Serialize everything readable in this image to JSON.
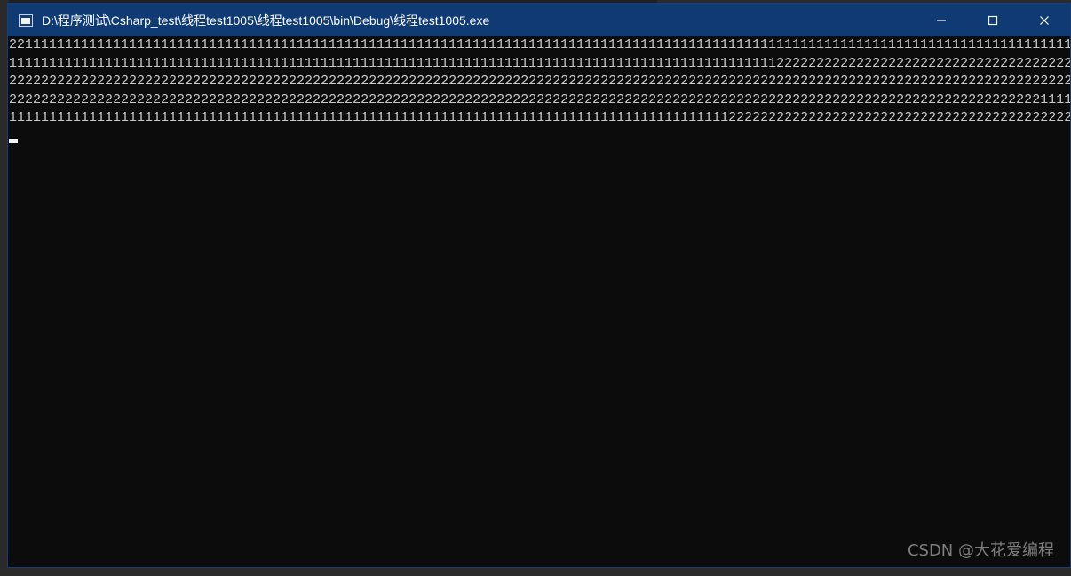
{
  "window": {
    "title": "D:\\程序测试\\Csharp_test\\线程test1005\\线程test1005\\bin\\Debug\\线程test1005.exe",
    "controls": {
      "minimize": "minimize-icon",
      "maximize": "maximize-icon",
      "close": "close-icon"
    }
  },
  "console": {
    "lines": [
      "2211111111111111111111111111111111111111111111111111111111111111111111111111111111111111111111111111111111111111111111111111111111111111111111",
      "1111111111111111111111111111111111111111111111111111111111111111111111111111111111111111111111112222222222222222222222222222222222222222222222",
      "2222222222222222222222222222222222222222222222222222222222222222222222222222222222222222222222222222222222222222222222222222222222222222222222",
      "2222222222222222222222222222222222222222222222222222222222222222222222222222222222222222222222222222222222222222222222222222222221111111111111",
      "1111111111111111111111111111111111111111111111111111111111111111111111111111111111111111112222222222222222222222222222222222222222222222222222"
    ]
  },
  "watermark": {
    "text": "CSDN @大花爱编程"
  },
  "colors": {
    "titlebar": "#0f3a74",
    "console_bg": "#0c0c0c",
    "console_text": "#c8c8c8"
  }
}
